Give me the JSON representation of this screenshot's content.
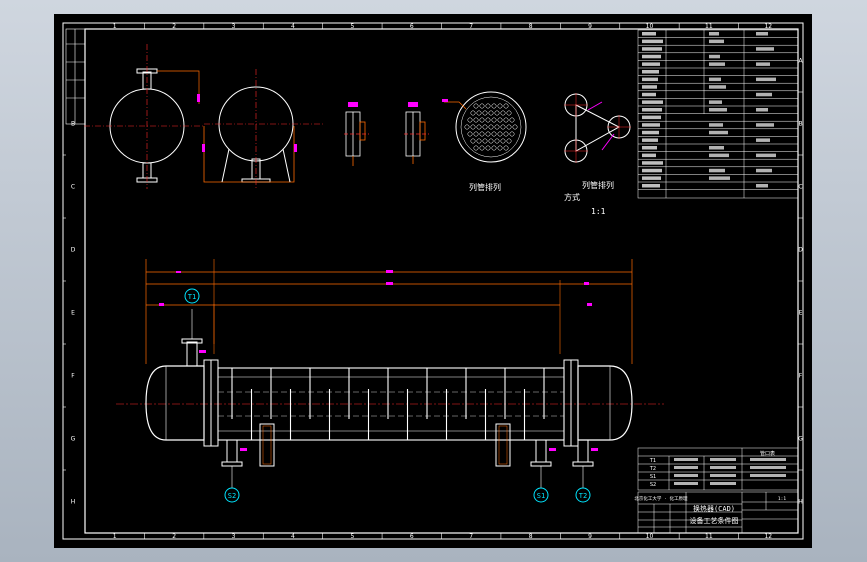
{
  "colors": {
    "frame": "#ffffff",
    "dim": "#ff00ff",
    "leader": "#ff6a00",
    "center": "#ff2a2a",
    "nozzle_tag": "#00e5ff",
    "tube": "#ffff66",
    "background": "#000000"
  },
  "grid": {
    "columns": [
      "1",
      "2",
      "3",
      "4",
      "5",
      "6",
      "7",
      "8",
      "9",
      "10",
      "11",
      "12"
    ],
    "rows": [
      "A",
      "B",
      "C",
      "D",
      "E",
      "F",
      "G",
      "H"
    ]
  },
  "labels": {
    "layout_title_1": "列管排列",
    "layout_title_2": "列管排列",
    "layout_mode": "方式",
    "scale": "1:1"
  },
  "nozzles": {
    "top": "T1",
    "bottom_left": "S2",
    "bottom_mid": "S1",
    "bottom_right": "T2"
  },
  "nozzle_table": {
    "header": "管口表",
    "rows": [
      [
        "T1",
        "",
        "",
        ""
      ],
      [
        "T2",
        "",
        "",
        ""
      ],
      [
        "S1",
        "",
        "",
        ""
      ],
      [
        "S2",
        "",
        "",
        ""
      ]
    ]
  },
  "title_block": {
    "school": "北京化工大学 · 化工原理",
    "drawing_name_1": "换热器(CAD)",
    "drawing_name_2": "设备工艺条件图",
    "scale_label": "1:1"
  }
}
